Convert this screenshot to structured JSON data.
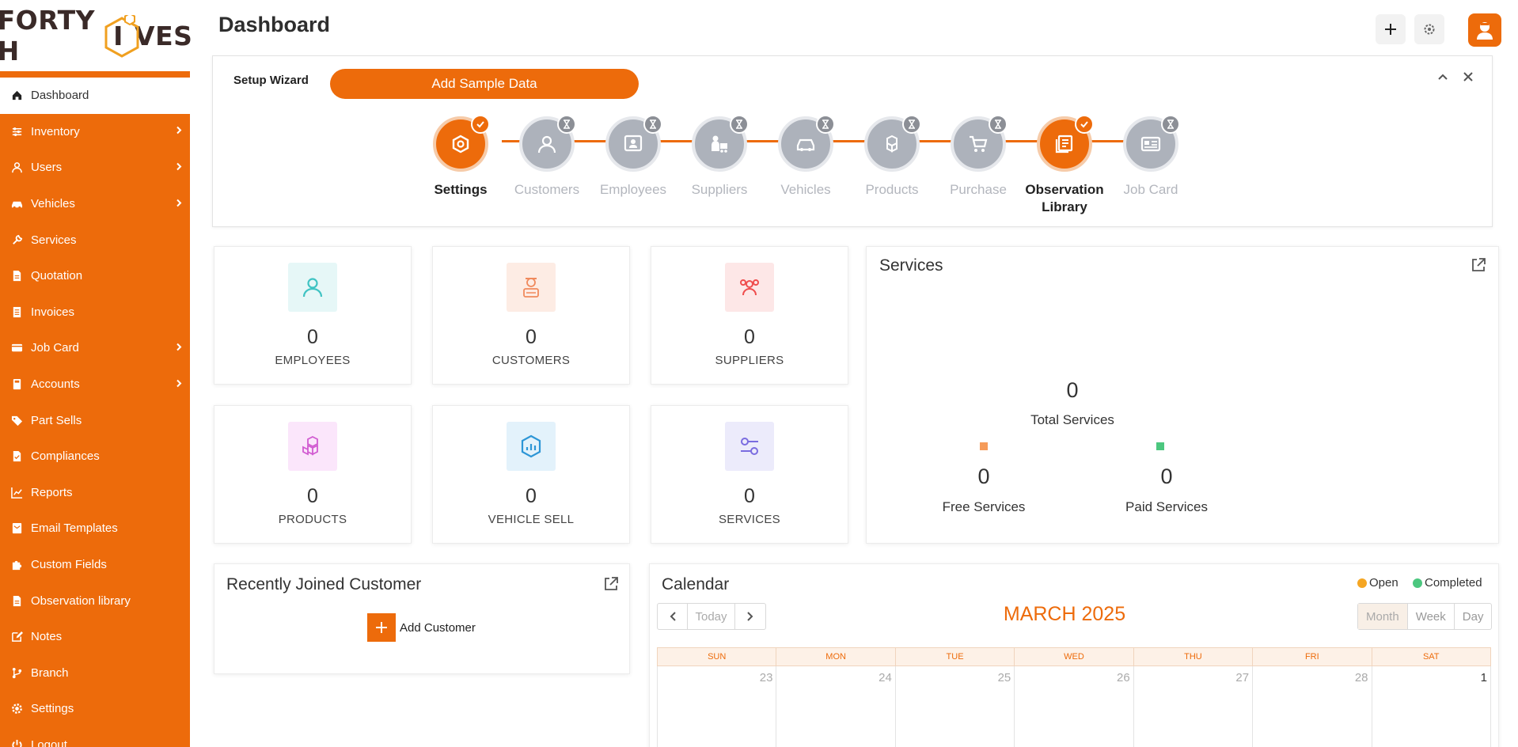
{
  "brand": {
    "logo_left": "FORTY H",
    "logo_mid": "I",
    "logo_right": "VES"
  },
  "colors": {
    "accent": "#ed6b0b",
    "open": "#f5a623",
    "completed": "#4cc77f"
  },
  "sidebar": {
    "items": [
      {
        "label": "Dashboard",
        "icon": "home-icon",
        "active": true
      },
      {
        "label": "Inventory",
        "icon": "sliders-icon",
        "has_submenu": true
      },
      {
        "label": "Users",
        "icon": "user-icon",
        "has_submenu": true
      },
      {
        "label": "Vehicles",
        "icon": "car-icon",
        "has_submenu": true
      },
      {
        "label": "Services",
        "icon": "wrench-icon"
      },
      {
        "label": "Quotation",
        "icon": "file-icon"
      },
      {
        "label": "Invoices",
        "icon": "file-lines-icon"
      },
      {
        "label": "Job Card",
        "icon": "card-icon",
        "has_submenu": true
      },
      {
        "label": "Accounts",
        "icon": "calculator-icon",
        "has_submenu": true
      },
      {
        "label": "Part Sells",
        "icon": "tag-icon"
      },
      {
        "label": "Compliances",
        "icon": "file-check-icon"
      },
      {
        "label": "Reports",
        "icon": "chart-icon"
      },
      {
        "label": "Email Templates",
        "icon": "envelope-file-icon"
      },
      {
        "label": "Custom Fields",
        "icon": "puzzle-icon"
      },
      {
        "label": "Observation library",
        "icon": "file-icon"
      },
      {
        "label": "Notes",
        "icon": "edit-icon"
      },
      {
        "label": "Branch",
        "icon": "branch-icon"
      },
      {
        "label": "Settings",
        "icon": "gear-icon"
      },
      {
        "label": "Logout",
        "icon": "power-icon"
      }
    ]
  },
  "header": {
    "title": "Dashboard"
  },
  "wizard": {
    "title": "Setup Wizard",
    "sample_button": "Add Sample Data",
    "steps": [
      {
        "label": "Settings",
        "done": true,
        "icon": "settings-hex-icon"
      },
      {
        "label": "Customers",
        "done": false,
        "icon": "customer-icon"
      },
      {
        "label": "Employees",
        "done": false,
        "icon": "employee-icon"
      },
      {
        "label": "Suppliers",
        "done": false,
        "icon": "supplier-icon"
      },
      {
        "label": "Vehicles",
        "done": false,
        "icon": "car-icon"
      },
      {
        "label": "Products",
        "done": false,
        "icon": "boxes-icon"
      },
      {
        "label": "Purchase",
        "done": false,
        "icon": "cart-icon"
      },
      {
        "label": "Observation Library",
        "done": true,
        "icon": "library-icon"
      },
      {
        "label": "Job Card",
        "done": false,
        "icon": "jobcard-icon"
      }
    ]
  },
  "stats": [
    {
      "value": "0",
      "label": "EMPLOYEES"
    },
    {
      "value": "0",
      "label": "CUSTOMERS"
    },
    {
      "value": "0",
      "label": "SUPPLIERS"
    },
    {
      "value": "0",
      "label": "PRODUCTS"
    },
    {
      "value": "0",
      "label": "VEHICLE SELL"
    },
    {
      "value": "0",
      "label": "SERVICES"
    }
  ],
  "services_card": {
    "title": "Services",
    "total_value": "0",
    "total_label": "Total Services",
    "free_value": "0",
    "free_label": "Free Services",
    "paid_value": "0",
    "paid_label": "Paid Services"
  },
  "recent": {
    "title": "Recently Joined Customer",
    "add_label": "Add Customer"
  },
  "calendar": {
    "title": "Calendar",
    "legend_open": "Open",
    "legend_completed": "Completed",
    "today_label": "Today",
    "month_label": "MARCH 2025",
    "views": [
      "Month",
      "Week",
      "Day"
    ],
    "weekdays": [
      "SUN",
      "MON",
      "TUE",
      "WED",
      "THU",
      "FRI",
      "SAT"
    ],
    "first_row": [
      "23",
      "24",
      "25",
      "26",
      "27",
      "28",
      "1"
    ]
  }
}
